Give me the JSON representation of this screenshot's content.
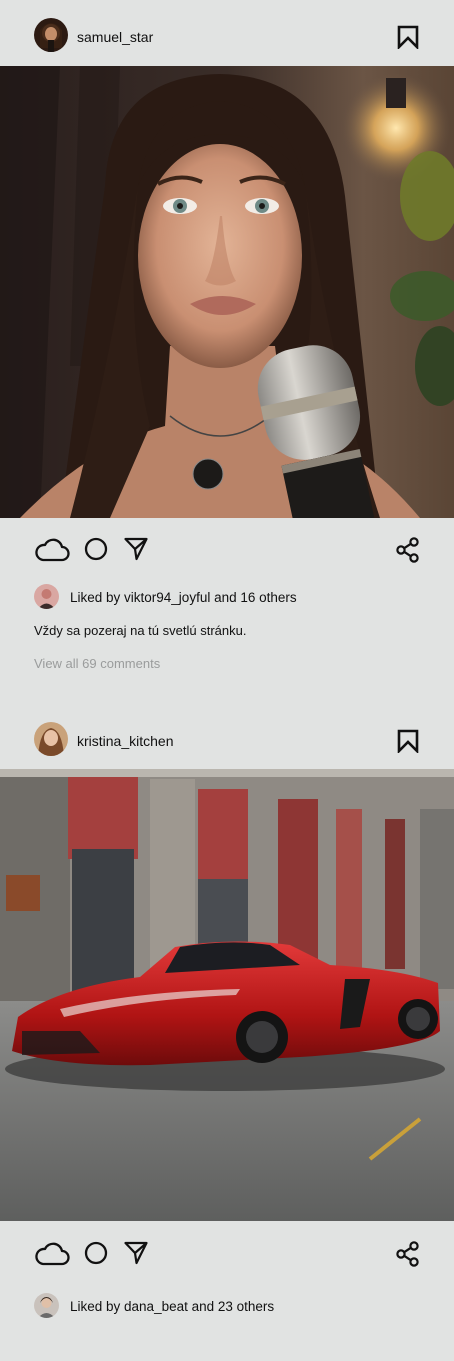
{
  "colors": {
    "background": "#e1e3e2",
    "text": "#111111",
    "muted": "#9a9c9c",
    "icon_stroke": "#111111"
  },
  "posts": [
    {
      "username": "samuel_star",
      "photo_description": "woman-with-microphone",
      "liked_by_text": "Liked by viktor94_joyful and 16 others",
      "caption": "Vždy sa pozeraj na  tú svetlú stránku.",
      "comments_link": "View all 69 comments"
    },
    {
      "username": "kristina_kitchen",
      "photo_description": "red-sports-car",
      "liked_by_text": "Liked by dana_beat and 23 others"
    }
  ],
  "icons": {
    "bookmark": "bookmark-icon",
    "like": "cloud-icon",
    "comment": "circle-icon",
    "send": "send-icon",
    "share": "share-icon"
  }
}
